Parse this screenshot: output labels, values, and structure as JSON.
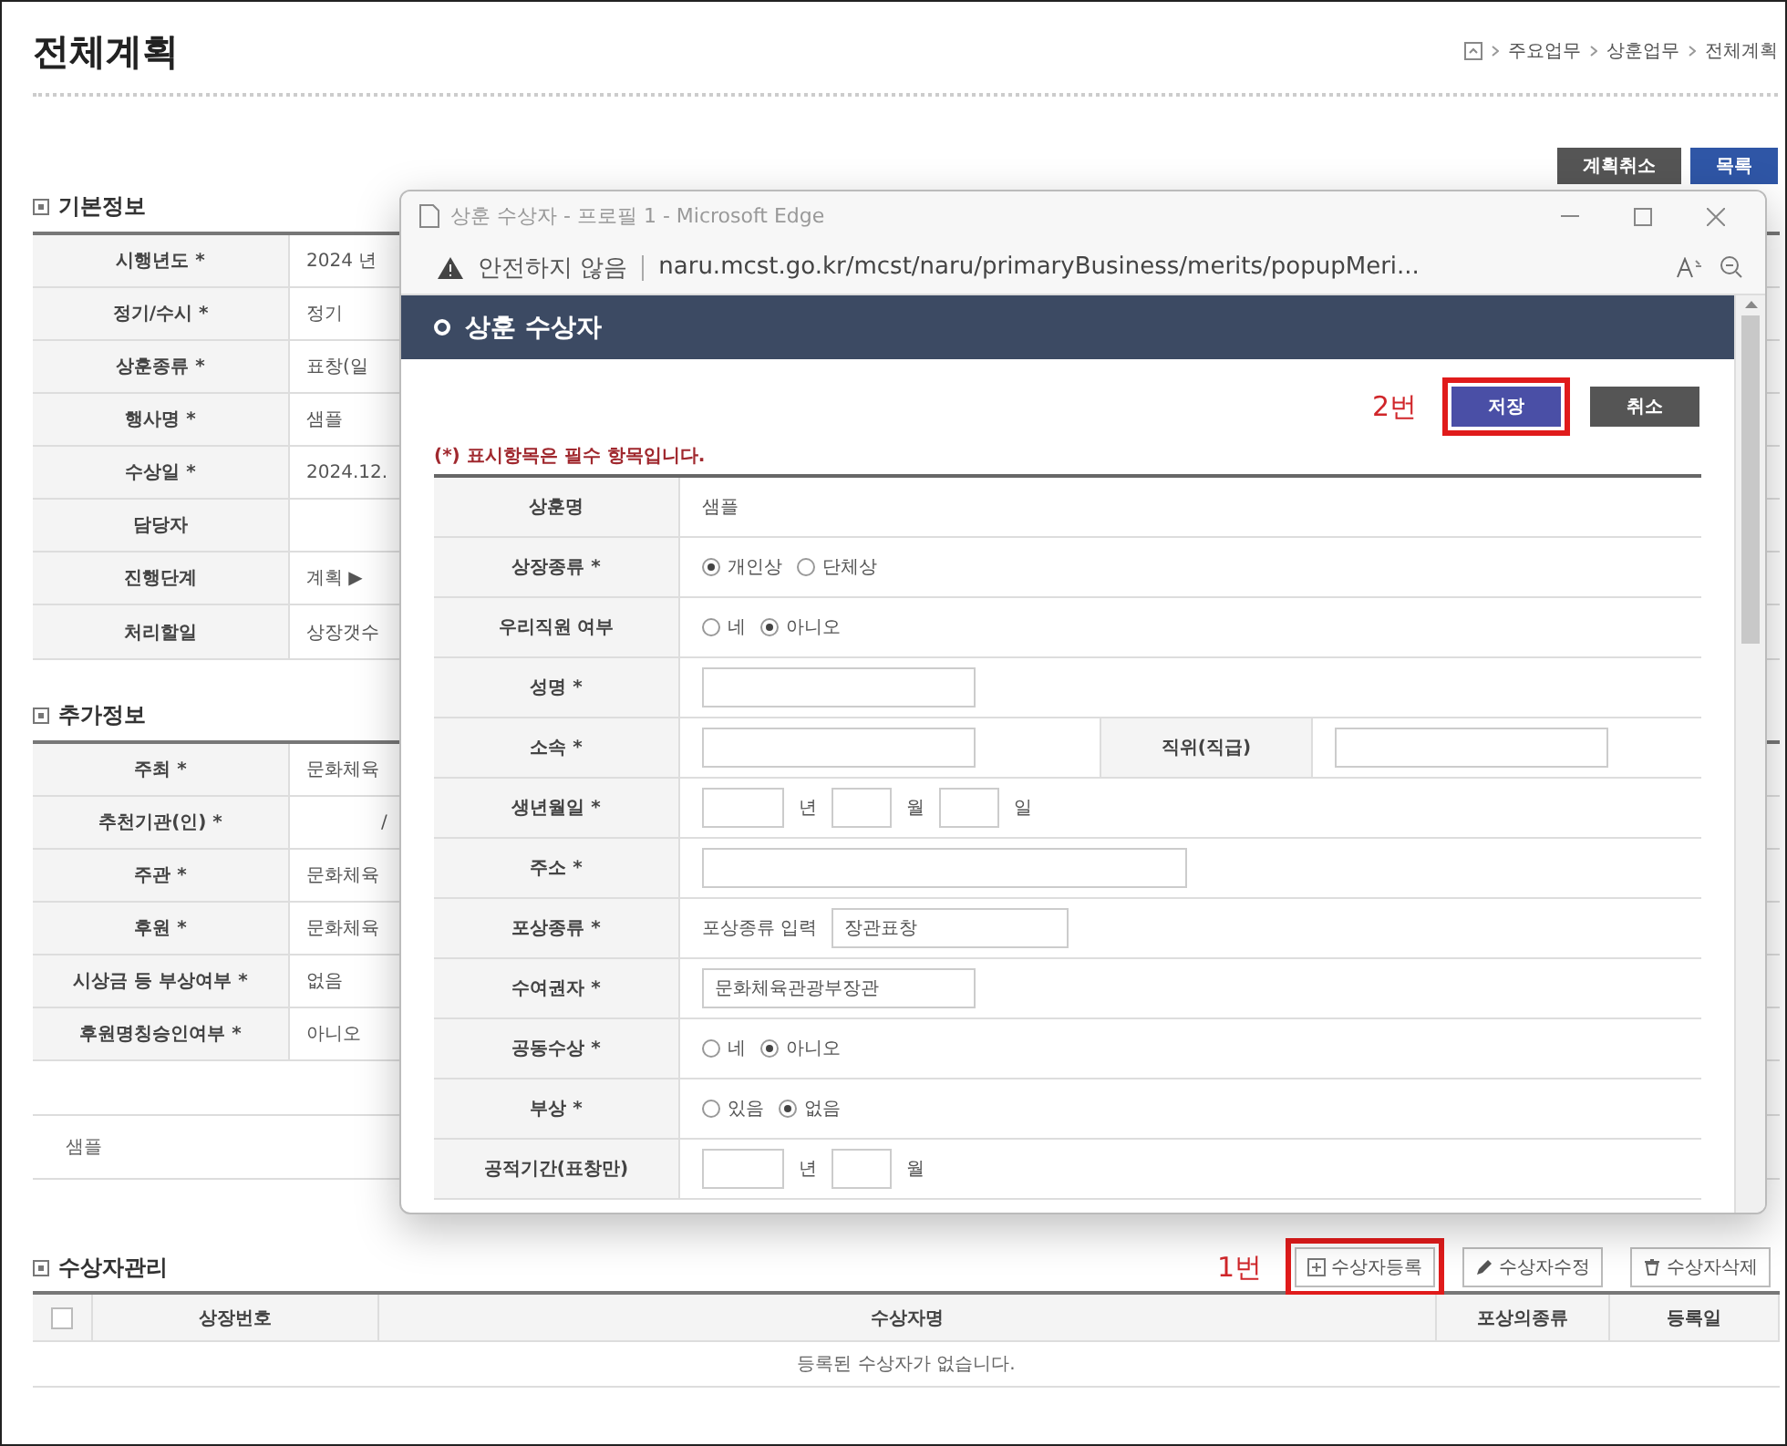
{
  "page": {
    "title": "전체계획",
    "breadcrumb": [
      "주요업무",
      "상훈업무",
      "전체계획"
    ]
  },
  "actions": [
    {
      "label": "계획취소",
      "kind": "dark"
    },
    {
      "label": "목록",
      "kind": "primary"
    }
  ],
  "basic_info": {
    "heading": "기본정보",
    "rows": [
      {
        "label": "시행년도 *",
        "kind": "text",
        "value": "2024 년"
      },
      {
        "label": "정기/수시 *",
        "kind": "text",
        "value": "정기"
      },
      {
        "label": "상훈종류 *",
        "kind": "text",
        "value": "표창(일"
      },
      {
        "label": "행사명 *",
        "kind": "text",
        "value": "샘플"
      },
      {
        "label": "수상일 *",
        "kind": "text",
        "value": "2024.12."
      },
      {
        "label": "담당자",
        "kind": "picker"
      },
      {
        "label": "진행단계",
        "kind": "text",
        "value": "계획 ▶"
      },
      {
        "label": "처리할일",
        "kind": "text",
        "value": "상장갯수"
      }
    ]
  },
  "additional_info": {
    "heading": "추가정보",
    "rows": [
      {
        "label": "주최 *",
        "kind": "text",
        "value": "문화체육"
      },
      {
        "label": "추천기관(인) *",
        "kind": "slash",
        "value": "/"
      },
      {
        "label": "주관 *",
        "kind": "text",
        "value": "문화체육"
      },
      {
        "label": "후원 *",
        "kind": "text",
        "value": "문화체육"
      },
      {
        "label": "시상금 등 부상여부 *",
        "kind": "text",
        "value": "없음"
      },
      {
        "label": "후원명칭승인여부 *",
        "kind": "text",
        "value": "아니오"
      }
    ],
    "note": "샘플"
  },
  "recipients": {
    "heading": "수상자관리",
    "annotation": "1번",
    "buttons": [
      {
        "label": "수상자등록",
        "highlighted": true
      },
      {
        "label": "수상자수정",
        "highlighted": false
      },
      {
        "label": "수상자삭제",
        "highlighted": false
      }
    ],
    "select_all": {
      "checked": false
    },
    "columns": [
      "상장번호",
      "수상자명",
      "포상의종류",
      "등록일"
    ],
    "empty_message": "등록된 수상자가 없습니다."
  },
  "popup": {
    "window_title": "상훈 수상자 - 프로필 1 - Microsoft Edge",
    "security": "안전하지 않음",
    "url": "naru.mcst.go.kr/mcst/naru/primaryBusiness/merits/popupMeri...",
    "header": "상훈 수상자",
    "annotation": "2번",
    "buttons": [
      {
        "label": "저장",
        "kind": "primary",
        "highlighted": true
      },
      {
        "label": "취소",
        "kind": "dark",
        "highlighted": false
      }
    ],
    "required_note": "(*) 표시항목은 필수 항목입니다.",
    "fields": [
      {
        "label": "상훈명",
        "kind": "text",
        "value": "샘플"
      },
      {
        "label": "상장종류 *",
        "kind": "radio",
        "options": [
          {
            "label": "개인상",
            "selected": true
          },
          {
            "label": "단체상",
            "selected": false
          }
        ]
      },
      {
        "label": "우리직원 여부",
        "kind": "radio",
        "options": [
          {
            "label": "네",
            "selected": false
          },
          {
            "label": "아니오",
            "selected": true
          }
        ]
      },
      {
        "label": "성명 *",
        "kind": "input"
      },
      {
        "label": "소속 *",
        "kind": "input_pair",
        "label2": "직위(직급)"
      },
      {
        "label": "생년월일 *",
        "kind": "date",
        "units": [
          "년",
          "월",
          "일"
        ]
      },
      {
        "label": "주소 *",
        "kind": "wide_input"
      },
      {
        "label": "포상종류 *",
        "kind": "labeled_input",
        "prefix": "포상종류 입력",
        "value": "장관표창"
      },
      {
        "label": "수여권자 *",
        "kind": "input",
        "value": "문화체육관광부장관"
      },
      {
        "label": "공동수상 *",
        "kind": "radio",
        "options": [
          {
            "label": "네",
            "selected": false
          },
          {
            "label": "아니오",
            "selected": true
          }
        ]
      },
      {
        "label": "부상 *",
        "kind": "radio",
        "options": [
          {
            "label": "있음",
            "selected": false
          },
          {
            "label": "없음",
            "selected": true
          }
        ]
      },
      {
        "label": "공적기간(표창만)",
        "kind": "date",
        "units": [
          "년",
          "월"
        ]
      }
    ]
  }
}
